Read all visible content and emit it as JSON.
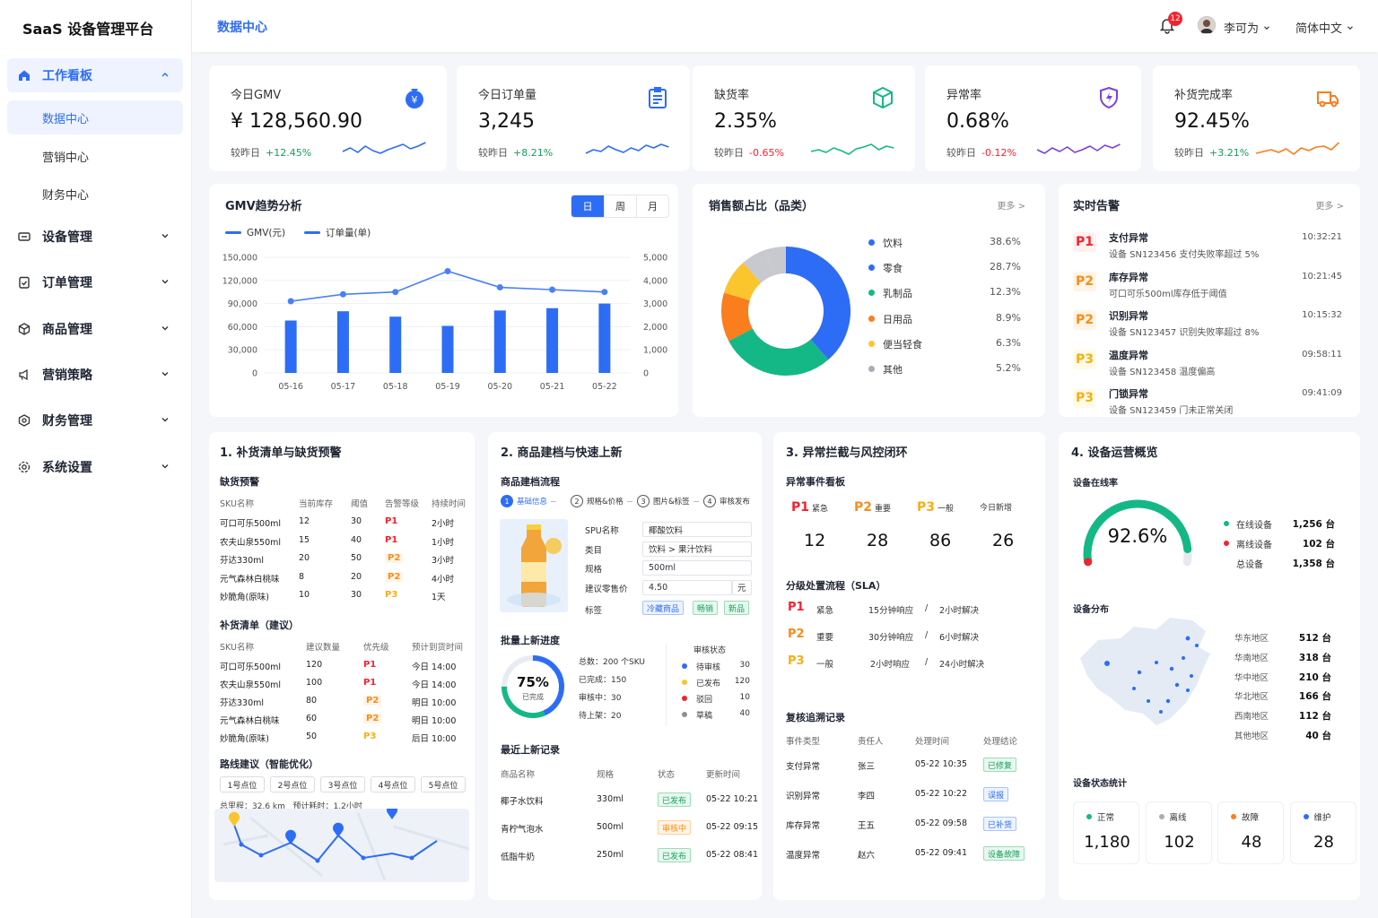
{
  "sidebar": {
    "brand": "SaaS 设备管理平台",
    "groups": [
      {
        "label": "工作看板"
      },
      {
        "label": "设备管理"
      },
      {
        "label": "订单管理"
      },
      {
        "label": "商品管理"
      },
      {
        "label": "营销策略"
      },
      {
        "label": "财务管理"
      },
      {
        "label": "系统设置"
      }
    ],
    "subitems": [
      "数据中心",
      "营销中心",
      "财务中心"
    ]
  },
  "header": {
    "title": "数据中心",
    "notification_count": "12",
    "user": "李可为",
    "language": "简体中文"
  },
  "kpis": [
    {
      "title": "今日GMV",
      "value": "¥ 128,560.90",
      "compare_label": "较昨日",
      "delta": "+12.45%",
      "color": "#2d6df6",
      "icon": "money-bag-icon"
    },
    {
      "title": "今日订单量",
      "value": "3,245",
      "compare_label": "较昨日",
      "delta": "+8.21%",
      "color": "#2d6df6",
      "icon": "clipboard-icon"
    },
    {
      "title": "缺货率",
      "value": "2.35%",
      "compare_label": "较昨日",
      "delta": "-0.65%",
      "color": "#14b886",
      "icon": "cube-icon"
    },
    {
      "title": "异常率",
      "value": "0.68%",
      "compare_label": "较昨日",
      "delta": "-0.12%",
      "color": "#7a3fe4",
      "icon": "shield-bolt-icon"
    },
    {
      "title": "补货完成率",
      "value": "92.45%",
      "compare_label": "较昨日",
      "delta": "+3.21%",
      "color": "#fa7d1e",
      "icon": "truck-icon"
    }
  ],
  "gmv_panel": {
    "title": "GMV趋势分析",
    "segments": [
      "日",
      "周",
      "月"
    ]
  },
  "chart_data": {
    "type": "bar",
    "categories": [
      "05-16",
      "05-17",
      "05-18",
      "05-19",
      "05-20",
      "05-21",
      "05-22"
    ],
    "series": [
      {
        "name": "GMV(元)",
        "type": "bar",
        "axis": "left",
        "values": [
          68000,
          80000,
          73000,
          61000,
          81000,
          84000,
          90000
        ]
      },
      {
        "name": "订单量(单)",
        "type": "line",
        "axis": "right",
        "values": [
          3100,
          3400,
          3500,
          4400,
          3700,
          3600,
          3500
        ]
      }
    ],
    "y_left": {
      "ticks": [
        "150,000",
        "120,000",
        "90,000",
        "60,000",
        "30,000",
        "0"
      ],
      "ylim": [
        0,
        150000
      ]
    },
    "y_right": {
      "ticks": [
        "5,000",
        "4,000",
        "3,000",
        "2,000",
        "1,000",
        "0"
      ],
      "ylim": [
        0,
        5000
      ]
    },
    "grid": true,
    "legend": "top-left"
  },
  "pie_panel": {
    "title": "销售额占比（品类）",
    "more": "更多 >",
    "slices": [
      {
        "name": "饮料",
        "pct": "38.6%",
        "value": 38.6,
        "color": "#2d6df6"
      },
      {
        "name": "零食",
        "pct": "28.7%",
        "value": 28.7,
        "color": "#14b886"
      },
      {
        "name": "乳制品",
        "pct": "12.3%",
        "value": 12.3,
        "color": "#fa7d1e"
      },
      {
        "name": "日用品",
        "pct": "8.9%",
        "value": 8.9,
        "color": "#fbc52d"
      },
      {
        "name": "便当轻食",
        "pct": "6.3%",
        "value": 6.3,
        "color": "#c7c9cf"
      },
      {
        "name": "其他",
        "pct": "5.2%",
        "value": 5.2,
        "color": "#c7c9cf"
      }
    ],
    "legend_colors": [
      "#2d6df6",
      "#2d6df6",
      "#14b886",
      "#fa7d1e",
      "#fbc52d",
      "#a9acb4"
    ]
  },
  "alerts_panel": {
    "title": "实时告警",
    "more": "更多 >",
    "items": [
      {
        "level": "P1",
        "title": "支付异常",
        "desc": "设备 SN123456 支付失败率超过 5%",
        "time": "10:32:21"
      },
      {
        "level": "P2",
        "title": "库存异常",
        "desc": "可口可乐500ml库存低于阈值",
        "time": "10:21:45"
      },
      {
        "level": "P2",
        "title": "识别异常",
        "desc": "设备 SN123457 识别失败率超过 8%",
        "time": "10:15:32"
      },
      {
        "level": "P3",
        "title": "温度异常",
        "desc": "设备 SN123458 温度偏高",
        "time": "09:58:11"
      },
      {
        "level": "P3",
        "title": "门锁异常",
        "desc": "设备 SN123459 门未正常关闭",
        "time": "09:41:09"
      }
    ]
  },
  "replenish": {
    "title": "1. 补货清单与缺货预警",
    "shortage_title": "缺货预警",
    "shortage_headers": [
      "SKU名称",
      "当前库存",
      "阈值",
      "告警等级",
      "持续时间"
    ],
    "shortage_rows": [
      [
        "可口可乐500ml",
        "12",
        "30",
        "P1",
        "2小时"
      ],
      [
        "农夫山泉550ml",
        "15",
        "40",
        "P1",
        "1小时"
      ],
      [
        "芬达330ml",
        "20",
        "50",
        "P2",
        "3小时"
      ],
      [
        "元气森林白桃味",
        "8",
        "20",
        "P2",
        "4小时"
      ],
      [
        "妙脆角(原味)",
        "10",
        "30",
        "P3",
        "1天"
      ]
    ],
    "list_title": "补货清单（建议）",
    "list_headers": [
      "SKU名称",
      "建议数量",
      "优先级",
      "预计到货时间"
    ],
    "list_rows": [
      [
        "可口可乐500ml",
        "120",
        "P1",
        "今日 14:00"
      ],
      [
        "农夫山泉550ml",
        "100",
        "P1",
        "今日 14:00"
      ],
      [
        "芬达330ml",
        "80",
        "P2",
        "明日 10:00"
      ],
      [
        "元气森林白桃味",
        "60",
        "P2",
        "明日 10:00"
      ],
      [
        "妙脆角(原味)",
        "50",
        "P3",
        "后日 10:00"
      ]
    ],
    "route_title": "路线建议（智能优化）",
    "route_points": [
      "1号点位",
      "2号点位",
      "3号点位",
      "4号点位",
      "5号点位"
    ],
    "route_distance_label": "总里程：",
    "route_distance": "32.6 km",
    "route_time_label": "预计耗时：",
    "route_time": "1.2小时"
  },
  "product": {
    "title": "2. 商品建档与快速上新",
    "flow_title": "商品建档流程",
    "steps": [
      "基础信息",
      "规格&价格",
      "图片&标签",
      "审核发布"
    ],
    "fields": [
      {
        "label": "SPU名称",
        "value": "椰酸饮料"
      },
      {
        "label": "类目",
        "value": "饮料 > 果汁饮料"
      },
      {
        "label": "规格",
        "value": "500ml"
      },
      {
        "label": "建议零售价",
        "value": "4.50"
      }
    ],
    "currency": "元",
    "tag_label": "标签",
    "tags": [
      "冷藏商品",
      "畅销",
      "新品"
    ],
    "batch_title": "批量上新进度",
    "progress": 0.75,
    "progress_label": "75%",
    "progress_sub": "已完成",
    "batch_stats": [
      "总数：200 个SKU",
      "已完成：150",
      "审核中：30",
      "待上架：20"
    ],
    "audit_title": "审核状态",
    "audit": [
      {
        "name": "待审核",
        "count": "30",
        "color": "#2d6df6"
      },
      {
        "name": "已发布",
        "count": "120",
        "color": "#fbc52d"
      },
      {
        "name": "驳回",
        "count": "10",
        "color": "#f5222d"
      },
      {
        "name": "草稿",
        "count": "40",
        "color": "#8c8f96"
      }
    ],
    "recent_title": "最近上新记录",
    "recent_headers": [
      "商品名称",
      "规格",
      "状态",
      "更新时间"
    ],
    "recent_rows": [
      [
        "椰子水饮料",
        "330ml",
        "已发布",
        "05-22 10:21"
      ],
      [
        "青柠气泡水",
        "500ml",
        "审核中",
        "05-22 09:15"
      ],
      [
        "低脂牛奶",
        "250ml",
        "已发布",
        "05-22 08:41"
      ]
    ]
  },
  "risk": {
    "title": "3. 异常拦截与风控闭环",
    "board_title": "异常事件看板",
    "board": [
      {
        "level": "P1",
        "label": "紧急",
        "count": "12"
      },
      {
        "level": "P2",
        "label": "重要",
        "count": "28"
      },
      {
        "level": "P3",
        "label": "一般",
        "count": "86"
      },
      {
        "level": "",
        "label": "今日新增",
        "count": "26"
      }
    ],
    "sla_title": "分级处置流程（SLA）",
    "sla": [
      {
        "level": "P1",
        "label": "紧急",
        "respond": "15分钟响应",
        "resolve": "2小时解决"
      },
      {
        "level": "P2",
        "label": "重要",
        "respond": "30分钟响应",
        "resolve": "6小时解决"
      },
      {
        "level": "P3",
        "label": "一般",
        "respond": "2小时响应",
        "resolve": "24小时解决"
      }
    ],
    "sla_sep": "/",
    "review_title": "复核追溯记录",
    "review_headers": [
      "事件类型",
      "责任人",
      "处理时间",
      "处理结论"
    ],
    "review_rows": [
      [
        "支付异常",
        "张三",
        "05-22 10:35",
        "已修复"
      ],
      [
        "识别异常",
        "李四",
        "05-22 10:22",
        "误报"
      ],
      [
        "库存异常",
        "王五",
        "05-22 09:58",
        "已补货"
      ],
      [
        "温度异常",
        "赵六",
        "05-22 09:41",
        "设备故障"
      ]
    ]
  },
  "ops": {
    "title": "4. 设备运营概览",
    "online_title": "设备在线率",
    "online_rate": 0.926,
    "online_rate_label": "92.6%",
    "online_stats": [
      {
        "name": "在线设备",
        "value": "1,256 台",
        "color": "#14b886"
      },
      {
        "name": "离线设备",
        "value": "102 台",
        "color": "#f5222d"
      },
      {
        "name": "总设备",
        "value": "1,358 台",
        "color": ""
      }
    ],
    "dist_title": "设备分布",
    "regions": [
      {
        "name": "华东地区",
        "value": "512 台"
      },
      {
        "name": "华南地区",
        "value": "318 台"
      },
      {
        "name": "华中地区",
        "value": "210 台"
      },
      {
        "name": "华北地区",
        "value": "166 台"
      },
      {
        "name": "西南地区",
        "value": "112 台"
      },
      {
        "name": "其他地区",
        "value": "40 台"
      }
    ],
    "status_title": "设备状态统计",
    "status": [
      {
        "name": "正常",
        "value": "1,180",
        "color": "#14b886"
      },
      {
        "name": "离线",
        "value": "102",
        "color": "#a9acb4"
      },
      {
        "name": "故障",
        "value": "48",
        "color": "#fa7d1e"
      },
      {
        "name": "维护",
        "value": "28",
        "color": "#2d6df6"
      }
    ]
  }
}
